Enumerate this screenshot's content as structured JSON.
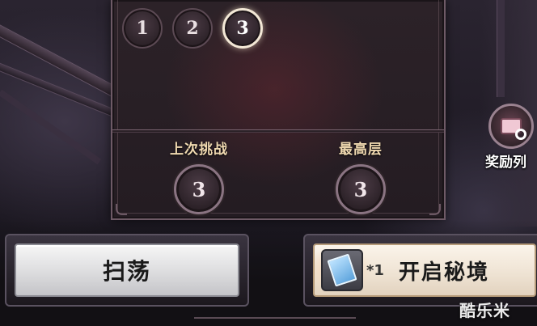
{
  "floor_selector": {
    "tabs": [
      {
        "label": "1",
        "active": false
      },
      {
        "label": "2",
        "active": false
      },
      {
        "label": "3",
        "active": true
      }
    ]
  },
  "stats": {
    "last_challenge": {
      "label": "上次挑战",
      "value": "3"
    },
    "highest_floor": {
      "label": "最高层",
      "value": "3"
    }
  },
  "reward_list": {
    "label": "奖励列",
    "icon": "reward-box-magnifier-icon"
  },
  "buttons": {
    "sweep_label": "扫荡",
    "open_label": "开启秘境",
    "key_count": "*1",
    "key_icon": "secret-realm-key-icon"
  },
  "watermark": "酷乐米",
  "colors": {
    "panel_bg": "#241c22",
    "panel_border": "#6e5a66",
    "label_gold": "#f0d9b0",
    "active_ring": "#f3e8d6"
  }
}
